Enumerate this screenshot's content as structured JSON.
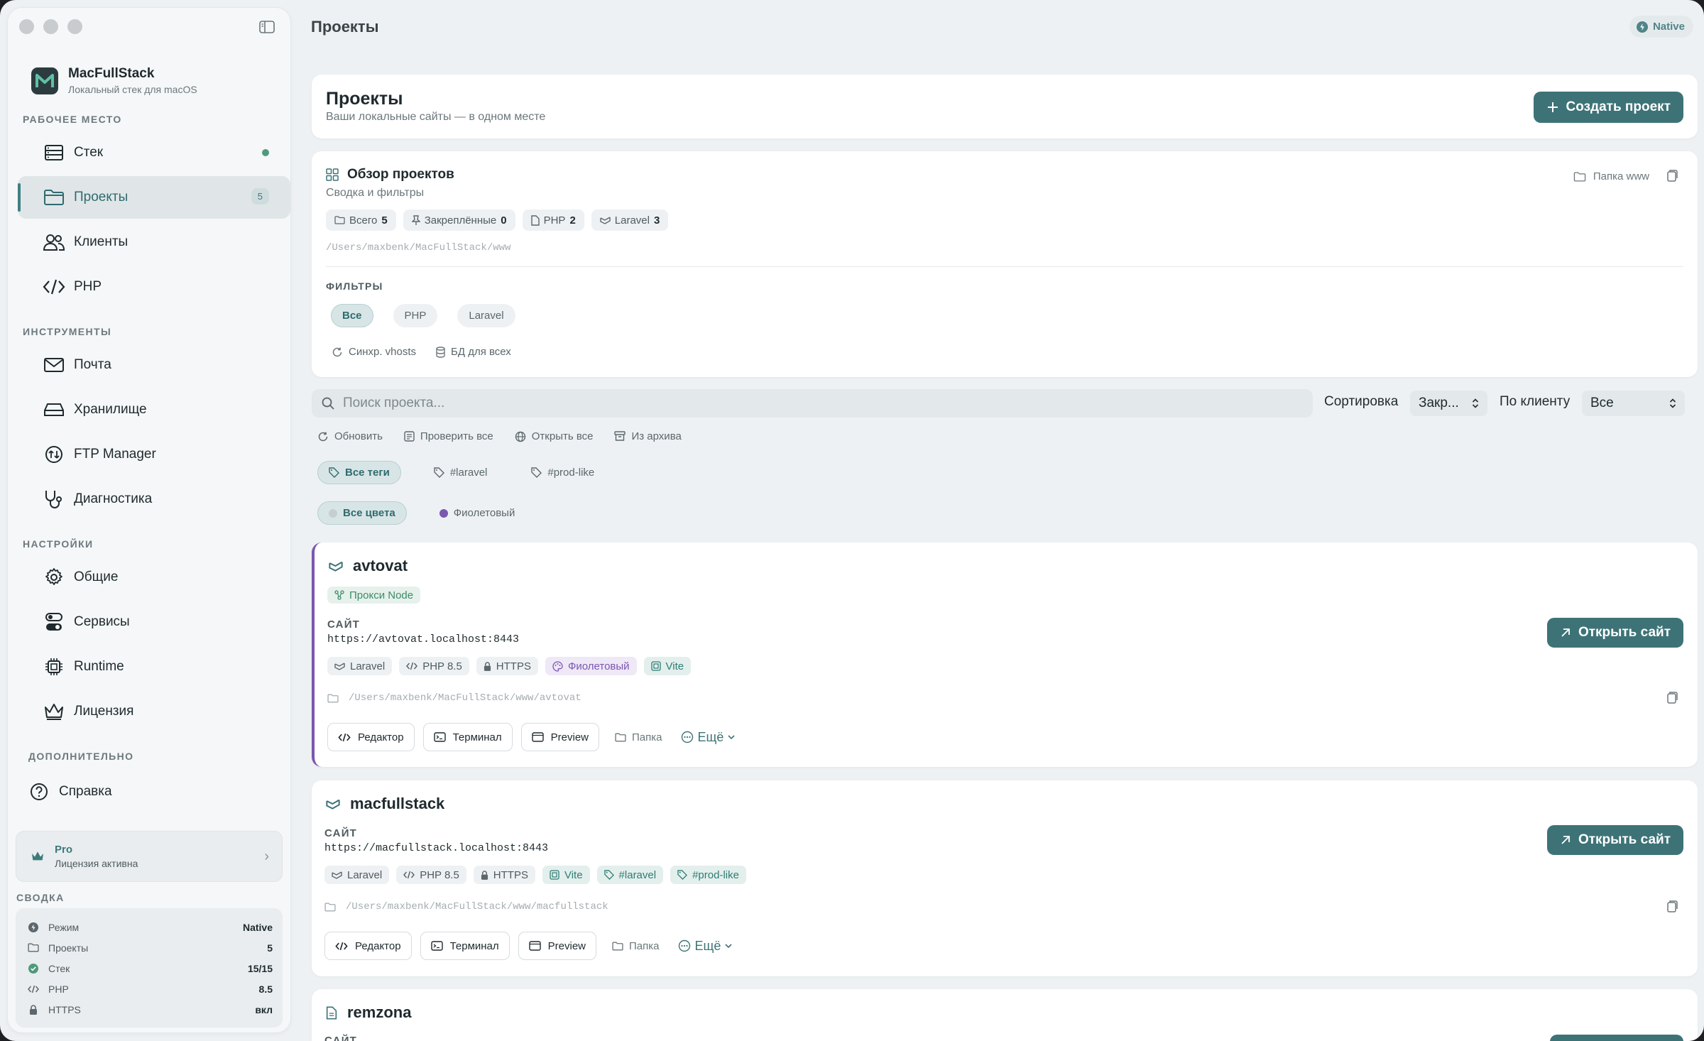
{
  "window": {
    "title": "Проекты",
    "mode_badge": "Native"
  },
  "sidebar": {
    "app_name": "MacFullStack",
    "app_subtitle": "Локальный стек для macOS",
    "sections": {
      "workspace": "РАБОЧЕЕ МЕСТО",
      "tools": "ИНСТРУМЕНТЫ",
      "settings": "НАСТРОЙКИ",
      "extra": "ДОПОЛНИТЕЛЬНО"
    },
    "items": [
      {
        "label": "Стек",
        "icon": "server-icon"
      },
      {
        "label": "Проекты",
        "icon": "folder-icon",
        "badge": "5"
      },
      {
        "label": "Клиенты",
        "icon": "users-icon"
      },
      {
        "label": "PHP",
        "icon": "code-icon"
      },
      {
        "label": "Почта",
        "icon": "mail-icon"
      },
      {
        "label": "Хранилище",
        "icon": "storage-icon"
      },
      {
        "label": "FTP Manager",
        "icon": "ftp-icon"
      },
      {
        "label": "Диагностика",
        "icon": "stethoscope-icon"
      },
      {
        "label": "Общие",
        "icon": "gear-icon"
      },
      {
        "label": "Сервисы",
        "icon": "toggles-icon"
      },
      {
        "label": "Runtime",
        "icon": "chip-icon"
      },
      {
        "label": "Лицензия",
        "icon": "crown-icon"
      },
      {
        "label": "Справка",
        "icon": "help-icon"
      }
    ],
    "pro_card": {
      "title": "Pro",
      "subtitle": "Лицензия активна"
    },
    "summary": {
      "title": "СВОДКА",
      "rows": [
        {
          "label": "Режим",
          "value": "Native"
        },
        {
          "label": "Проекты",
          "value": "5"
        },
        {
          "label": "Стек",
          "value": "15/15"
        },
        {
          "label": "PHP",
          "value": "8.5"
        },
        {
          "label": "HTTPS",
          "value": "вкл"
        }
      ]
    }
  },
  "header": {
    "title": "Проекты",
    "subtitle": "Ваши локальные сайты — в одном месте",
    "create_button": "Создать проект"
  },
  "overview": {
    "title": "Обзор проектов",
    "subtitle": "Сводка и фильтры",
    "www_folder": "Папка www",
    "stats": [
      {
        "label": "Всего",
        "value": "5"
      },
      {
        "label": "Закреплённые",
        "value": "0"
      },
      {
        "label": "PHP",
        "value": "2"
      },
      {
        "label": "Laravel",
        "value": "3"
      }
    ],
    "path": "/Users/maxbenk/MacFullStack/www",
    "filters_title": "ФИЛЬТРЫ",
    "filters": [
      "Все",
      "PHP",
      "Laravel"
    ],
    "sync_vhosts": "Синхр. vhosts",
    "db_all": "БД для всех"
  },
  "search": {
    "placeholder": "Поиск проекта...",
    "sort_label": "Сортировка",
    "sort_value": "Закр...",
    "client_label": "По клиенту",
    "client_value": "Все"
  },
  "actions": {
    "refresh": "Обновить",
    "check_all": "Проверить все",
    "open_all": "Открыть все",
    "from_archive": "Из архива"
  },
  "tag_filters": [
    "Все теги",
    "#laravel",
    "#prod-like"
  ],
  "color_filters": [
    "Все цвета",
    "Фиолетовый"
  ],
  "colors": {
    "accent": "#3d7377",
    "purple": "#7b57b0"
  },
  "projects": [
    {
      "name": "avtovat",
      "proxy_badge": "Прокси Node",
      "site_label": "САЙТ",
      "url": "https://avtovat.localhost:8443",
      "tags": [
        "Laravel",
        "PHP 8.5",
        "HTTPS",
        "Фиолетовый",
        "Vite"
      ],
      "path": "/Users/maxbenk/MacFullStack/www/avtovat",
      "open_button": "Открыть сайт",
      "buttons": {
        "editor": "Редактор",
        "terminal": "Терминал",
        "preview": "Preview",
        "folder": "Папка",
        "more": "Ещё"
      }
    },
    {
      "name": "macfullstack",
      "site_label": "САЙТ",
      "url": "https://macfullstack.localhost:8443",
      "tags": [
        "Laravel",
        "PHP 8.5",
        "HTTPS",
        "Vite",
        "#laravel",
        "#prod-like"
      ],
      "path": "/Users/maxbenk/MacFullStack/www/macfullstack",
      "open_button": "Открыть сайт",
      "buttons": {
        "editor": "Редактор",
        "terminal": "Терминал",
        "preview": "Preview",
        "folder": "Папка",
        "more": "Ещё"
      }
    },
    {
      "name": "remzona",
      "site_label": "САЙТ"
    }
  ]
}
